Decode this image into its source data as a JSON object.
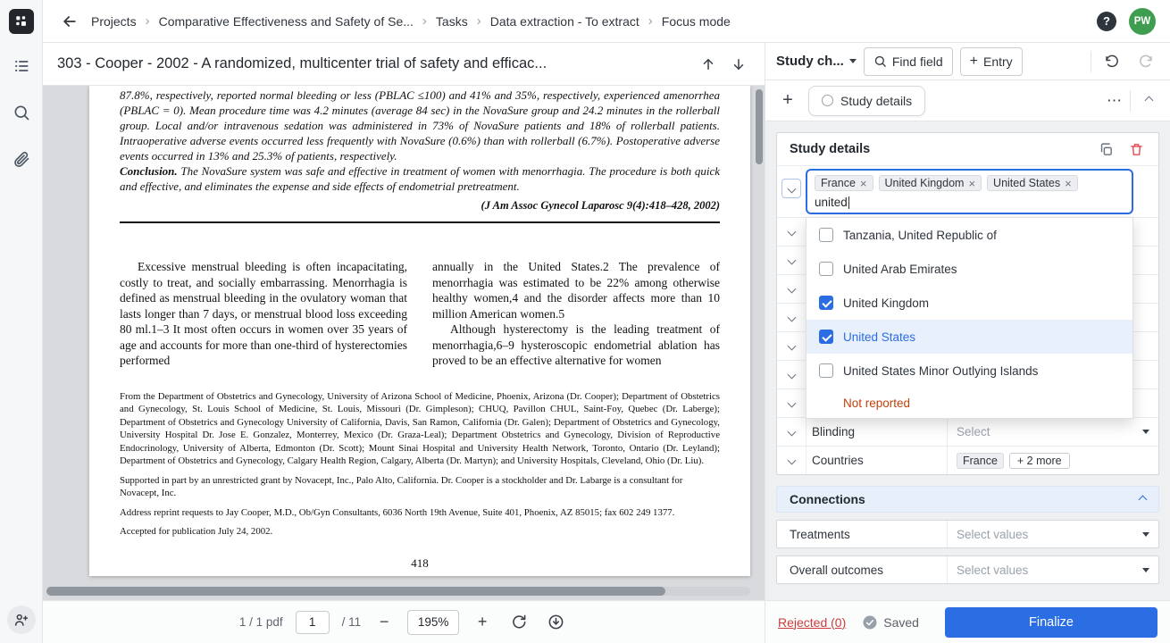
{
  "topbar": {
    "breadcrumb": [
      "Projects",
      "Comparative Effectiveness and Safety of Se...",
      "Tasks",
      "Data extraction - To extract",
      "Focus mode"
    ],
    "avatar": "PW"
  },
  "icons": {
    "separator": "›",
    "help": "?",
    "close": "×",
    "more": "⋯",
    "plus": "+",
    "minus": "−"
  },
  "pdf": {
    "doc_title": "303 - Cooper - 2002 - A randomized, multicenter trial of safety and efficac...",
    "toolbar": {
      "doc_info": "1 / 1 pdf",
      "page": "1",
      "page_total": "/ 11",
      "zoom": "195%"
    }
  },
  "document": {
    "abstract_tail": "87.8%, respectively, reported normal bleeding or less (PBLAC ≤100) and 41% and 35%, respectively, experienced amenorrhea (PBLAC = 0). Mean procedure time was 4.2 minutes (average 84 sec) in the NovaSure group and 24.2 minutes in the rollerball group. Local and/or intravenous sedation was administered in 73% of NovaSure patients and 18% of rollerball patients. Intraoperative adverse events occurred less frequently with NovaSure (0.6%) than with rollerball (6.7%). Postoperative adverse events occurred in 13% and 25.3% of patients, respectively.",
    "conclusion_label": "Conclusion.",
    "conclusion_text": " The NovaSure system was safe and effective in treatment of women with menorrhagia. The procedure is both quick and effective, and eliminates the expense and side effects of endometrial pretreatment.",
    "citation": "(J Am Assoc Gynecol Laparosc 9(4):418–428, 2002)",
    "col1": "Excessive menstrual bleeding is often incapacitating, costly to treat, and socially embarrassing. Menorrhagia is defined as menstrual bleeding in the ovulatory woman that lasts longer than 7 days, or menstrual blood loss exceeding 80 ml.1–3 It most often occurs in women over 35 years of age and accounts for more than one-third of hysterectomies performed",
    "col2_p1": "annually in the United States.2 The prevalence of menorrhagia was estimated to be 22% among otherwise healthy women,4 and the disorder affects more than 10 million American women.5",
    "col2_p2": "Although hysterectomy is the leading treatment of menorrhagia,6–9 hysteroscopic endometrial ablation has proved to be an effective alternative for women",
    "affiliations": "From the Department of Obstetrics and Gynecology, University of Arizona School of Medicine, Phoenix, Arizona (Dr. Cooper); Department of Obstetrics and Gynecology, St. Louis School of Medicine, St. Louis, Missouri (Dr. Gimpleson); CHUQ, Pavillon CHUL, Saint-Foy, Quebec (Dr. Laberge); Department of Obstetrics and Gynecology University of California, Davis, San Ramon, California (Dr. Galen); Department of Obstetrics and Gynecology, University Hospital Dr. Jose E. Gonzalez, Monterrey, Mexico (Dr. Graza-Leal); Department Obstetrics and Gynecology, Division of Reproductive Endocrinology, University of Alberta, Edmonton (Dr. Scott); Mount Sinai Hospital and University Health Network, Toronto, Ontario (Dr. Leyland); Department of Obstetrics and Gynecology, Calgary Health Region, Calgary, Alberta (Dr. Martyn); and University Hospitals, Cleveland, Ohio (Dr. Liu).",
    "support": "Supported in part by an unrestricted grant by Novacept, Inc., Palo Alto, California. Dr. Cooper is a stockholder and Dr. Labarge is a consultant for Novacept, Inc.",
    "reprints": "Address reprint requests to Jay Cooper, M.D., Ob/Gyn Consultants, 6036 North 19th Avenue, Suite 401, Phoenix, AZ 85015; fax 602 249 1377.",
    "accepted": "Accepted for publication July 24, 2002.",
    "page_number": "418"
  },
  "panel": {
    "template_label": "Study ch...",
    "find_field_label": "Find field",
    "entry_label": "Entry",
    "tab_label": "Study details",
    "card_title": "Study details",
    "multiselect": {
      "chips": [
        "France",
        "United Kingdom",
        "United States"
      ],
      "query": "united"
    },
    "dropdown": {
      "options": [
        {
          "label": "Tanzania, United Republic of",
          "checked": false
        },
        {
          "label": "United Arab Emirates",
          "checked": false
        },
        {
          "label": "United Kingdom",
          "checked": true
        },
        {
          "label": "United States",
          "checked": true
        },
        {
          "label": "United States Minor Outlying Islands",
          "checked": false
        }
      ],
      "not_reported": "Not reported"
    },
    "fields": [
      {
        "label": "Blinding",
        "placeholder": "Select"
      },
      {
        "label": "Countries",
        "chip": "France",
        "more": "+ 2 more"
      }
    ],
    "connections": {
      "title": "Connections",
      "rows": [
        {
          "label": "Treatments",
          "placeholder": "Select values"
        },
        {
          "label": "Overall outcomes",
          "placeholder": "Select values"
        }
      ]
    }
  },
  "footer": {
    "rejected": "Rejected (0)",
    "saved": "Saved",
    "finalize": "Finalize"
  },
  "colors": {
    "accent": "#2b6de3",
    "danger": "#e5484d",
    "not_reported": "#c2410c",
    "avatar": "#3f9d4f"
  }
}
